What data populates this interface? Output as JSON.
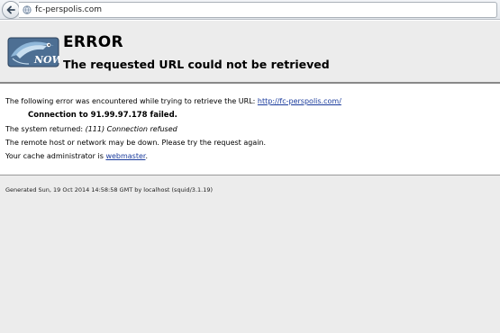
{
  "browser": {
    "url": "fc-perspolis.com"
  },
  "header": {
    "title": "ERROR",
    "subtitle": "The requested URL could not be retrieved",
    "logo_text": "NOW"
  },
  "content": {
    "line1_prefix": "The following error was encountered while trying to retrieve the URL: ",
    "line1_link": "http://fc-perspolis.com/",
    "failure": "Connection to 91.99.97.178 failed.",
    "returned_prefix": "The system returned: ",
    "returned_value": "(111) Connection refused",
    "remote_down": "The remote host or network may be down. Please try the request again.",
    "admin_prefix": "Your cache administrator is ",
    "admin_link": "webmaster",
    "admin_suffix": "."
  },
  "footer": {
    "generated": "Generated Sun, 19 Oct 2014 14:58:58 GMT by localhost (squid/3.1.19)"
  },
  "colors": {
    "link": "#1a3b9c",
    "header_bg": "#ececec"
  }
}
